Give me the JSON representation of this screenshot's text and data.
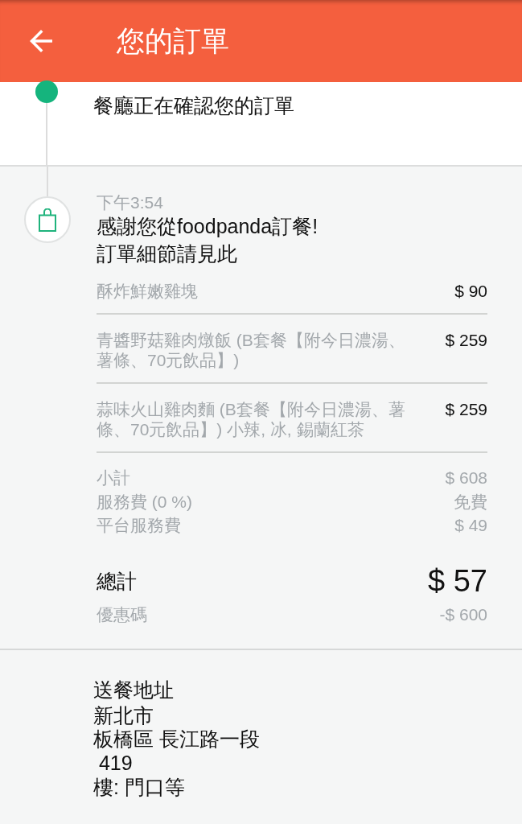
{
  "header": {
    "title": "您的訂單"
  },
  "status_event": {
    "message": "餐廳正在確認您的訂單"
  },
  "order_event": {
    "time": "下午3:54",
    "messages": [
      "感謝您從foodpanda訂餐!",
      "訂單細節請見此"
    ],
    "items": [
      {
        "name": "酥炸鮮嫩雞塊",
        "price": "$ 90"
      },
      {
        "name": "青醬野菇雞肉燉飯 (B套餐【附今日濃湯、薯條、70元飲品】)",
        "price": "$ 259"
      },
      {
        "name": "蒜味火山雞肉麵 (B套餐【附今日濃湯、薯條、70元飲品】) 小辣, 冰, 錫蘭紅茶",
        "price": "$ 259"
      }
    ],
    "fees": [
      {
        "label": "小計",
        "value": "$ 608"
      },
      {
        "label": "服務費 (0 %)",
        "value": "免費"
      },
      {
        "label": "平台服務費",
        "value": "$ 49"
      }
    ],
    "total": {
      "label": "總計",
      "value": "$ 57"
    },
    "discount": {
      "label": "優惠碼",
      "value": "-$ 600"
    }
  },
  "delivery_address": {
    "title": "送餐地址",
    "lines": [
      "新北市",
      "板橋區 長江路一段",
      " 419",
      "樓: 門口等"
    ]
  }
}
